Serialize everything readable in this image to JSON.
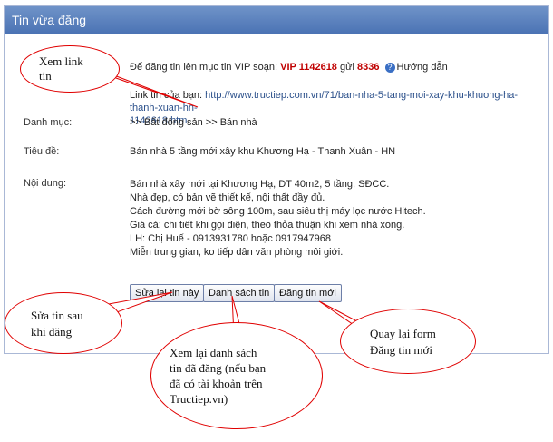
{
  "panel": {
    "title": "Tin vừa đăng"
  },
  "vip": {
    "prefix": "Để đăng tin lên mục tin VIP soạn: ",
    "code": "VIP 1142618",
    "mid": " gửi ",
    "number": "8336",
    "help_label": "Hướng dẫn"
  },
  "link": {
    "label": "Link tin của bạn: ",
    "url_line1": "http://www.tructiep.com.vn/71/ban-nha-5-tang-moi-xay-khu-khuong-ha-thanh-xuan-hn-",
    "url_line2": "1142618.htm"
  },
  "category": {
    "label": "Danh mục:",
    "value": ">> Bất động sản >> Bán nhà"
  },
  "title_row": {
    "label": "Tiêu đề:",
    "value": "Bán nhà 5 tầng mới xây khu Khương Hạ - Thanh Xuân - HN"
  },
  "content": {
    "label": "Nội dung:",
    "lines": [
      "Bán nhà xây mới tại Khương Hạ, DT 40m2, 5 tầng, SĐCC.",
      "Nhà đẹp, có bản vẽ thiết kế, nội thất đầy đủ.",
      "Cách đường mới bờ sông 100m, sau siêu thị máy lọc nước Hitech.",
      "Giá cả: chi tiết khi gọi điện, theo thỏa thuận khi xem nhà xong.",
      "LH: Chị Huế - 0913931780 hoặc 0917947968",
      "Miễn trung gian, ko tiếp dân văn phòng môi giới."
    ]
  },
  "buttons": {
    "edit": "Sửa lại tin này",
    "list": "Danh sách tin",
    "new": "Đăng tin mới"
  },
  "callouts": {
    "view_link": {
      "line1": "Xem link",
      "line2": "tin"
    },
    "edit": {
      "line1": "Sửa tin sau",
      "line2": "khi đăng"
    },
    "list": {
      "line1": "Xem lại danh sách",
      "line2": "tin đã đăng (nếu bạn",
      "line3": "đã có tài khoản trên",
      "line4": "Tructiep.vn)"
    },
    "new": {
      "line1": "Quay lại form",
      "line2": "Đăng tin mới"
    }
  }
}
